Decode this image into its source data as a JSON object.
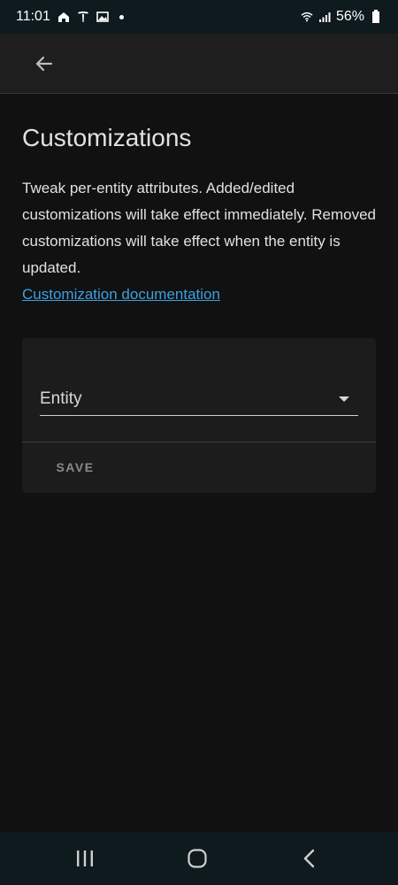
{
  "status_bar": {
    "time": "11:01",
    "battery": "56%",
    "icons_left": [
      "home-icon",
      "tesla-icon",
      "image-icon",
      "notification-dot"
    ],
    "icons_right": [
      "wifi-icon",
      "signal-icon",
      "battery-icon"
    ]
  },
  "app_bar": {
    "back_icon": "arrow-left-icon"
  },
  "page": {
    "title": "Customizations",
    "description": "Tweak per-entity attributes. Added/edited customizations will take effect immediately. Removed customizations will take effect when the entity is updated.",
    "doc_link": "Customization documentation"
  },
  "form": {
    "entity_label": "Entity",
    "save_label": "SAVE"
  },
  "nav_bar": {
    "items": [
      "recents-icon",
      "home-icon",
      "back-icon"
    ]
  },
  "colors": {
    "background": "#111111",
    "card": "#1c1c1c",
    "link": "#3d9fe0",
    "text": "#e1e1e1"
  }
}
